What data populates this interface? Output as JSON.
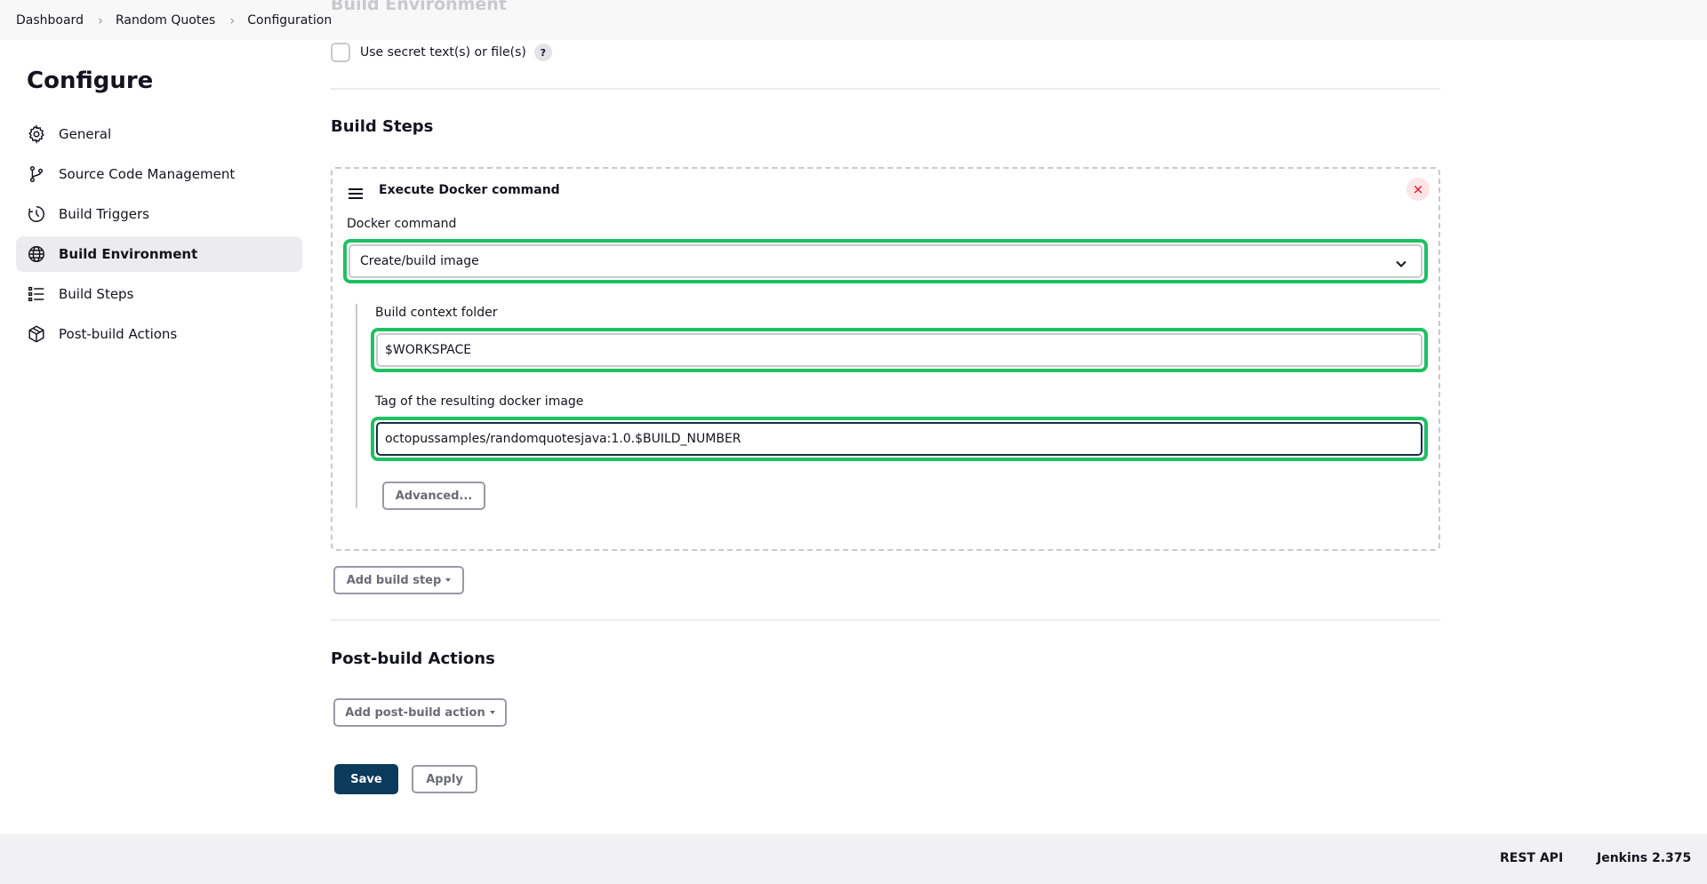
{
  "breadcrumb": {
    "items": [
      "Dashboard",
      "Random Quotes",
      "Configuration"
    ]
  },
  "ghost_section": "Build Environment",
  "sidebar": {
    "title": "Configure",
    "items": [
      {
        "label": "General",
        "icon": "gear-icon"
      },
      {
        "label": "Source Code Management",
        "icon": "branch-icon"
      },
      {
        "label": "Build Triggers",
        "icon": "clock-icon"
      },
      {
        "label": "Build Environment",
        "icon": "globe-icon",
        "active": true
      },
      {
        "label": "Build Steps",
        "icon": "list-icon"
      },
      {
        "label": "Post-build Actions",
        "icon": "package-icon"
      }
    ]
  },
  "build_env": {
    "secret_label": "Use secret text(s) or file(s)",
    "secret_checked": false,
    "help": "?"
  },
  "build_steps": {
    "title": "Build Steps",
    "step": {
      "title": "Execute Docker command",
      "close": "×",
      "docker_command_label": "Docker command",
      "docker_command_value": "Create/build image",
      "context_label": "Build context folder",
      "context_value": "$WORKSPACE",
      "tag_label": "Tag of the resulting docker image",
      "tag_value": "octopussamples/randomquotesjava:1.0.$BUILD_NUMBER",
      "advanced_label": "Advanced..."
    },
    "add_label": "Add build step"
  },
  "post_build": {
    "title": "Post-build Actions",
    "add_label": "Add post-build action"
  },
  "actions": {
    "save": "Save",
    "apply": "Apply"
  },
  "footer": {
    "rest_api": "REST API",
    "version": "Jenkins 2.375"
  },
  "colors": {
    "highlight": "#1ec162",
    "primary": "#0b3a5b",
    "danger": "#e6001f"
  }
}
